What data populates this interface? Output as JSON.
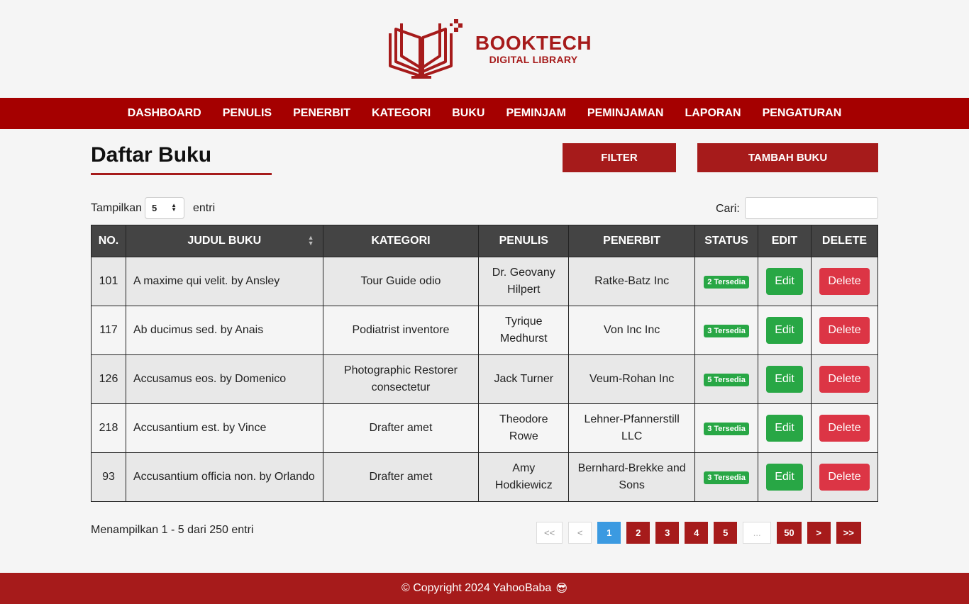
{
  "brand": {
    "title": "BOOKTECH",
    "subtitle": "DIGITAL LIBRARY",
    "color": "#a61b1b"
  },
  "nav": [
    "DASHBOARD",
    "PENULIS",
    "PENERBIT",
    "KATEGORI",
    "BUKU",
    "PEMINJAM",
    "PEMINJAMAN",
    "LAPORAN",
    "PENGATURAN"
  ],
  "page": {
    "title": "Daftar Buku",
    "filter_label": "FILTER",
    "add_label": "TAMBAH BUKU"
  },
  "controls": {
    "show_label": "Tampilkan",
    "show_value": "5",
    "entries_label": "entri",
    "search_label": "Cari:",
    "search_value": ""
  },
  "table": {
    "headers": [
      "NO.",
      "JUDUL BUKU",
      "KATEGORI",
      "PENULIS",
      "PENERBIT",
      "STATUS",
      "EDIT",
      "DELETE"
    ],
    "edit_label": "Edit",
    "delete_label": "Delete",
    "rows": [
      {
        "no": "101",
        "title": "A maxime qui velit. by Ansley",
        "category": "Tour Guide odio",
        "author": "Dr. Geovany Hilpert",
        "publisher": "Ratke-Batz Inc",
        "status": "2 Tersedia"
      },
      {
        "no": "117",
        "title": "Ab ducimus sed. by Anais",
        "category": "Podiatrist inventore",
        "author": "Tyrique Medhurst",
        "publisher": "Von Inc Inc",
        "status": "3 Tersedia"
      },
      {
        "no": "126",
        "title": "Accusamus eos. by Domenico",
        "category": "Photographic Restorer consectetur",
        "author": "Jack Turner",
        "publisher": "Veum-Rohan Inc",
        "status": "5 Tersedia"
      },
      {
        "no": "218",
        "title": "Accusantium est. by Vince",
        "category": "Drafter amet",
        "author": "Theodore Rowe",
        "publisher": "Lehner-Pfannerstill LLC",
        "status": "3 Tersedia"
      },
      {
        "no": "93",
        "title": "Accusantium officia non. by Orlando",
        "category": "Drafter amet",
        "author": "Amy Hodkiewicz",
        "publisher": "Bernhard-Brekke and Sons",
        "status": "3 Tersedia"
      }
    ]
  },
  "summary": "Menampilkan 1 - 5 dari 250 entri",
  "pagination": [
    "<<",
    "<",
    "1",
    "2",
    "3",
    "4",
    "5",
    "...",
    "50",
    ">",
    ">>"
  ],
  "footer": {
    "text": "© Copyright 2024 YahooBaba",
    "emoji": "😎"
  }
}
